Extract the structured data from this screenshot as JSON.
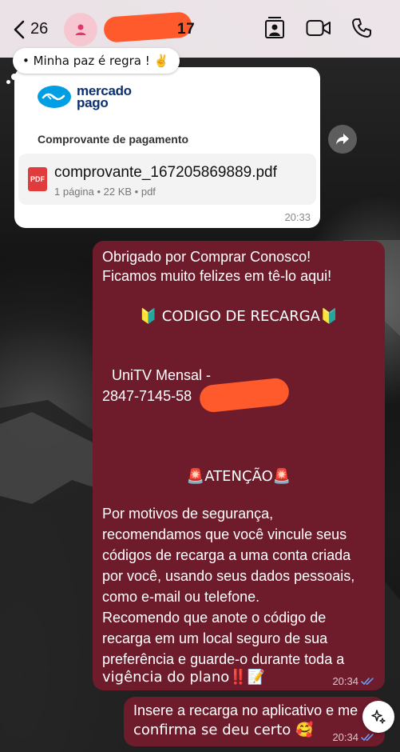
{
  "header": {
    "back_count": "26",
    "contact_name": "17",
    "colors": {
      "accent": "#ff5a2c",
      "avatar_bg": "#f7c7d1"
    },
    "icons": [
      "back-chevron-icon",
      "person-icon",
      "contact-card-icon",
      "video-call-icon",
      "phone-icon"
    ]
  },
  "status": {
    "text": "• Minha paz é regra ! ✌️"
  },
  "doc_message": {
    "brand_line1": "mercado",
    "brand_line2": "pago",
    "heading": "Comprovante de pagamento",
    "file_name": "comprovante_167205869889.pdf",
    "file_meta": "1 página • 22 KB • pdf",
    "file_icon_label": "PDF",
    "time": "20:33"
  },
  "recharge_message": {
    "line1": "Obrigado por Comprar Conosco!",
    "line2": "Ficamos muito felizes em tê-lo aqui!",
    "code_title": "🔰 CODIGO DE RECARGA🔰",
    "product": "UniTV Mensal -",
    "code": "2847-7145-58",
    "attention": "🚨ATENÇÃO🚨",
    "p1": "Por motivos de segurança,",
    "p2": "recomendamos que você vincule seus",
    "p3": "códigos de recarga a uma conta criada",
    "p4": "por você, usando seus dados pessoais,",
    "p5": "como e-mail ou telefone.",
    "p6": "Recomendo que anote o código de",
    "p7": "recarga em um local seguro de sua",
    "p8": "preferência e guarde-o durante toda a",
    "p9": "vigência do plano‼️📝",
    "time": "20:34"
  },
  "last_message": {
    "line1": "Insere a recarga no aplicativo e me",
    "line2": "confirma se deu certo 🥰",
    "time": "20:34"
  },
  "colors": {
    "outgoing_bubble": "#6e1b2b",
    "incoming_bubble": "#ffffff",
    "read_ticks": "#6aa6ff"
  }
}
